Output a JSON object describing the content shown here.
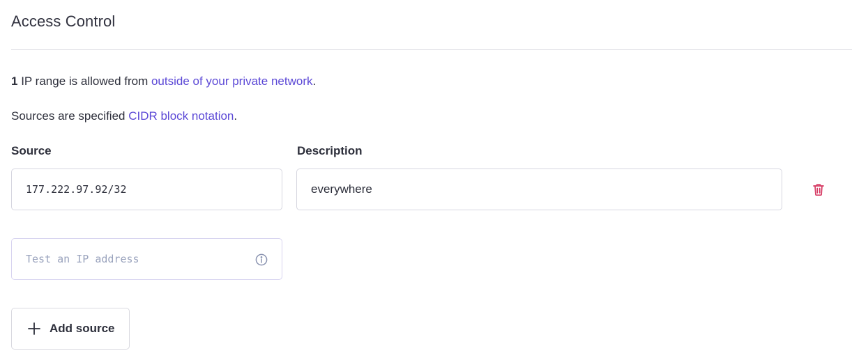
{
  "header": {
    "title": "Access Control"
  },
  "summary": {
    "count": "1",
    "text_before": " IP range is allowed from ",
    "link": "outside of your private network",
    "text_after": "."
  },
  "notation": {
    "text_before": "Sources are specified ",
    "link": "CIDR block notation",
    "text_after": "."
  },
  "columns": {
    "source": "Source",
    "description": "Description"
  },
  "rules": [
    {
      "source": "177.222.97.92/32",
      "description": "everywhere"
    }
  ],
  "test": {
    "placeholder": "Test an IP address"
  },
  "add_button": {
    "label": "Add source"
  },
  "icons": {
    "info": "info-icon",
    "trash": "trash-icon",
    "plus": "plus-icon"
  },
  "colors": {
    "link": "#5b48d6",
    "danger": "#d63a63",
    "text": "#2d2f3b"
  }
}
